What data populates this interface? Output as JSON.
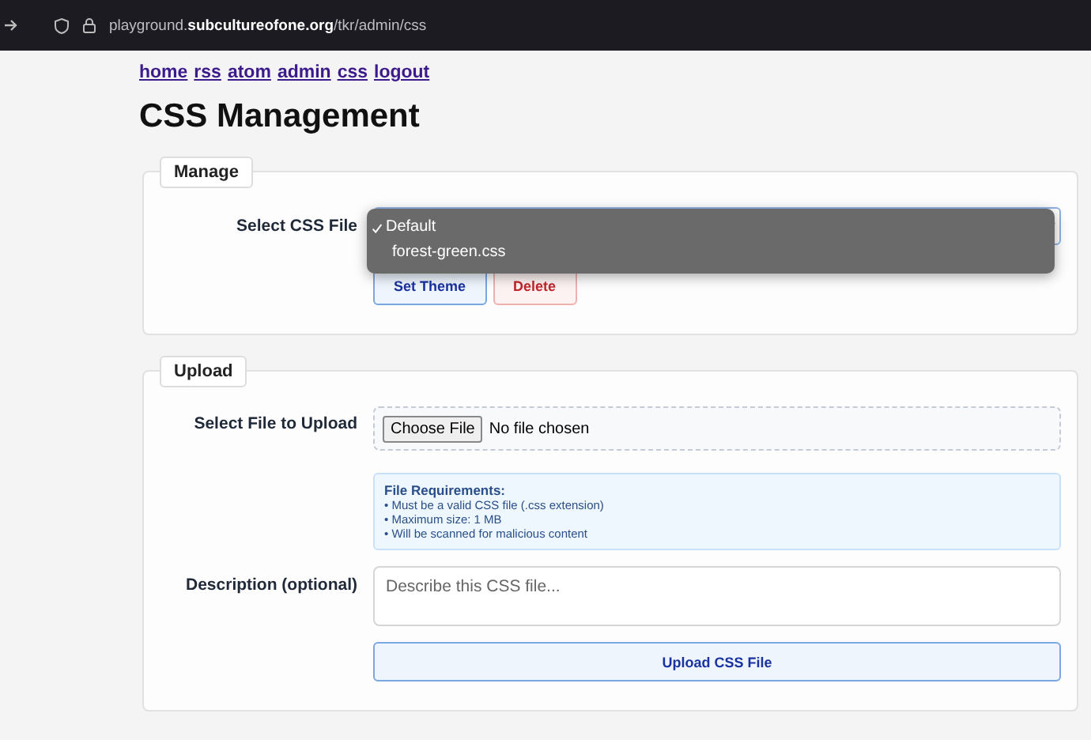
{
  "browser": {
    "url": "playground.**subcultureofone.org**/tkr/admin/css"
  },
  "nav": [
    "home",
    "rss",
    "atom",
    "admin",
    "css",
    "logout"
  ],
  "title": "CSS Management",
  "manage": {
    "legend": "Manage",
    "label": "Select CSS File",
    "options": [
      {
        "label": "Default",
        "selected": true
      },
      {
        "label": "forest-green.css",
        "selected": false
      }
    ],
    "buttons": [
      {
        "label": "Set Theme",
        "kind": "primary"
      },
      {
        "label": "Delete",
        "kind": "danger"
      }
    ]
  },
  "upload": {
    "legend": "Upload",
    "file_label": "Select File to Upload",
    "choose_button": "Choose File",
    "file_status": "No file chosen",
    "requirements_title": "File Requirements:",
    "requirements": [
      "• Must be a valid CSS file (.css extension)",
      "• Maximum size: 1 MB",
      "• Will be scanned for malicious content"
    ],
    "description_label": "Description (optional)",
    "description_placeholder": "Describe this CSS file...",
    "submit": "Upload CSS File"
  }
}
